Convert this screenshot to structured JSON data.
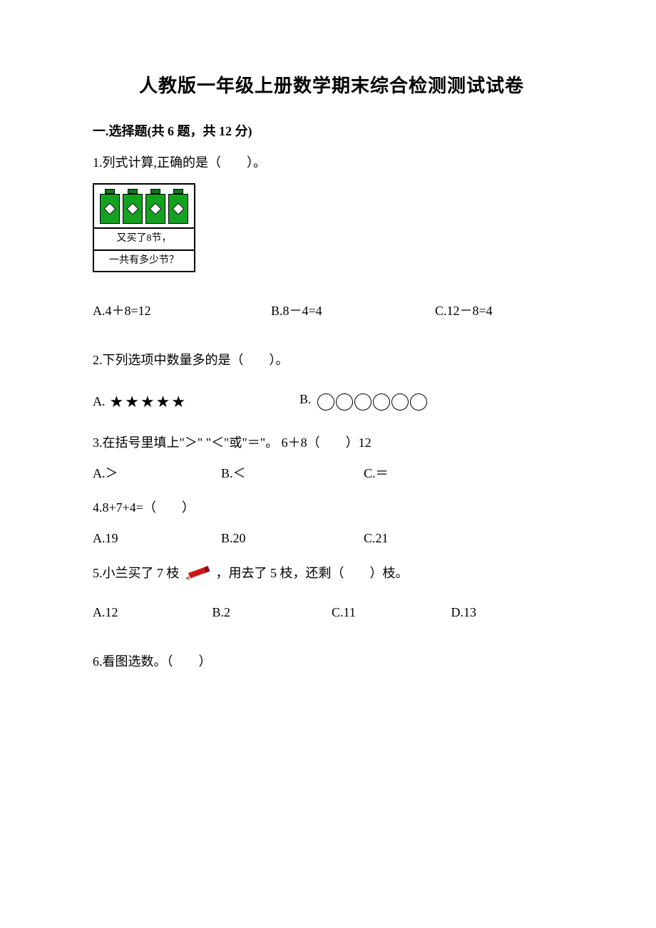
{
  "title": "人教版一年级上册数学期末综合检测测试试卷",
  "section1": {
    "header": "一.选择题(共 6 题，共 12 分)",
    "q1": {
      "stem": "1.列式计算,正确的是（　　）。",
      "figure": {
        "caption1": "又买了8节，",
        "caption2": "一共有多少节？"
      },
      "A": "A.4＋8=12",
      "B": "B.8－4=4",
      "C": "C.12－8=4"
    },
    "q2": {
      "stem": "2.下列选项中数量多的是（　　）。",
      "A_label": "A.",
      "A_stars": "★★★★★",
      "B_label": "B."
    },
    "q3": {
      "stem": "3.在括号里填上\"＞\" \"＜\"或\"＝\"。 6＋8（　　）12",
      "A": "A.＞",
      "B": "B.＜",
      "C": "C.＝"
    },
    "q4": {
      "stem": "4.8+7+4=（　　）",
      "A": "A.19",
      "B": "B.20",
      "C": "C.21"
    },
    "q5": {
      "stem_a": "5.小兰买了 7 枝 ",
      "stem_b": " ，用去了 5 枝，还剩（　　）枝。",
      "A": "A.12",
      "B": "B.2",
      "C": "C.11",
      "D": "D.13"
    },
    "q6": {
      "stem": "6.看图选数。（　　）"
    }
  }
}
